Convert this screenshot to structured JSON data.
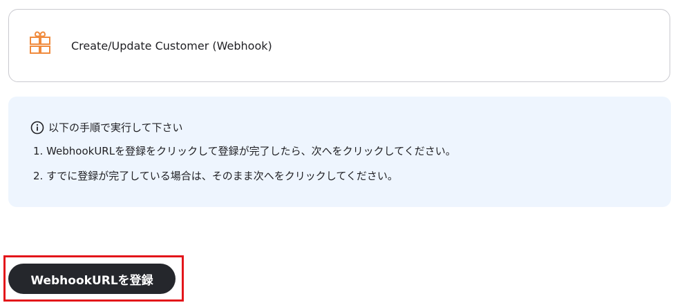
{
  "trigger": {
    "icon": "gift-box-icon",
    "label": "Create/Update Customer (Webhook)"
  },
  "instructions": {
    "icon": "info-circle-icon",
    "heading": "以下の手順で実行して下さい",
    "steps": [
      "1. WebhookURLを登録をクリックして登録が完了したら、次へをクリックしてください。",
      "2. すでに登録が完了している場合は、そのまま次へをクリックしてください。"
    ]
  },
  "actions": {
    "register_label": "WebhookURLを登録"
  },
  "colors": {
    "icon_orange": "#f08a3c",
    "info_background": "#eef5fe",
    "button_background": "#25272c",
    "highlight": "#e3151a"
  }
}
